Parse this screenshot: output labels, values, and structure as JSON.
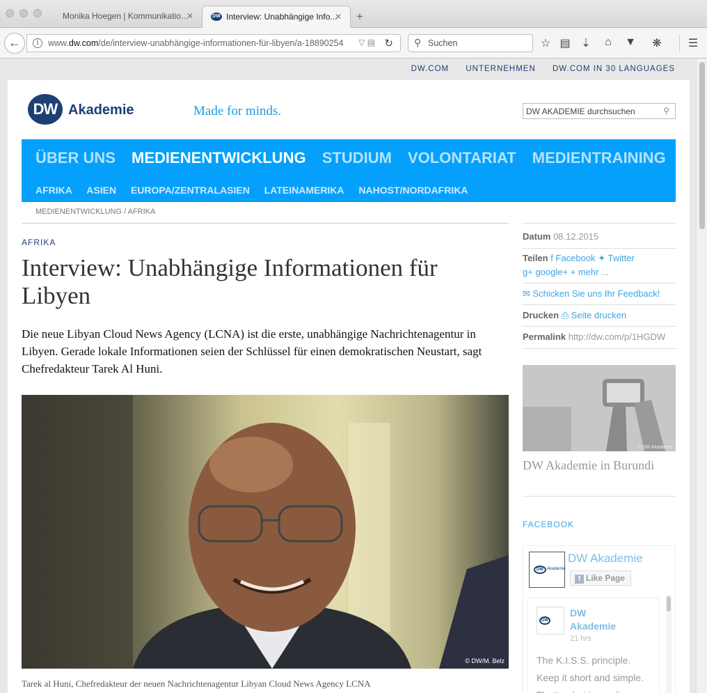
{
  "browser": {
    "tabs": [
      {
        "title": "Monika Hoegen | Kommunikatio...",
        "active": false
      },
      {
        "title": "Interview: Unabhängige Info...",
        "active": true,
        "favicon": "DW"
      }
    ],
    "new_tab": "+",
    "close_glyph": "✕",
    "url_prefix": "www.",
    "url_host": "dw.com",
    "url_path": "/de/interview-unabhängige-informationen-für-libyen/a-18890254",
    "search_placeholder": "Suchen",
    "icons": [
      "bookmark-star-icon",
      "reading-list-icon",
      "download-icon",
      "home-icon",
      "pocket-icon",
      "extension-icon",
      "menu-icon"
    ]
  },
  "toplinks": [
    "DW.COM",
    "UNTERNEHMEN",
    "DW.COM IN 30 LANGUAGES"
  ],
  "header": {
    "logo": "DW",
    "logo_text": "Akademie",
    "slogan": "Made for minds.",
    "search_placeholder": "DW AKADEMIE durchsuchen"
  },
  "nav": {
    "main": [
      {
        "label": "ÜBER UNS",
        "current": false
      },
      {
        "label": "MEDIENENTWICKLUNG",
        "current": true
      },
      {
        "label": "STUDIUM",
        "current": false
      },
      {
        "label": "VOLONTARIAT",
        "current": false
      },
      {
        "label": "MEDIENTRAINING",
        "current": false
      }
    ],
    "sub": [
      "AFRIKA",
      "ASIEN",
      "EUROPA/ZENTRALASIEN",
      "LATEINAMERIKA",
      "NAHOST/NORDAFRIKA"
    ]
  },
  "breadcrumb": {
    "first": "MEDIENENTWICKLUNG",
    "separator": " / ",
    "second": "AFRIKA"
  },
  "article": {
    "kicker": "AFRIKA",
    "headline": "Interview: Unabhängige Informationen für Libyen",
    "teaser": "Die neue Libyan Cloud News Agency (LCNA) ist die erste, unabhängige Nachrichtenagentur in Libyen. Gerade lokale Informationen seien der Schlüssel für einen demokratischen Neustart, sagt Chefredakteur Tarek Al Huni.",
    "photo_credit": "© DW/M. Belz",
    "caption": "Tarek al Huni, Chefredakteur der neuen Nachrichtenagentur Libyan Cloud News Agency LCNA"
  },
  "sidebar": {
    "date_label": "Datum",
    "date_value": "08.12.2015",
    "share_label": "Teilen",
    "facebook": "Facebook",
    "twitter": "Twitter",
    "google": "google+",
    "more": "mehr ...",
    "feedback": "Schicken Sie uns Ihr Feedback!",
    "print_label": "Drucken",
    "print_link": "Seite drucken",
    "permalink_label": "Permalink",
    "permalink_value": "http://dw.com/p/1HGDW",
    "promo_credit": "© DW Akademie",
    "promo_title": "DW Akademie in Burundi",
    "facebook_heading": "FACEBOOK",
    "fb_page_name": "DW Akademie",
    "fb_like": "Like Page",
    "fb_post_name": "DW Akademie",
    "fb_post_time": "21 hrs",
    "fb_post_text": "The K.I.S.S. principle. Keep it short and simple. That's what journalism"
  }
}
